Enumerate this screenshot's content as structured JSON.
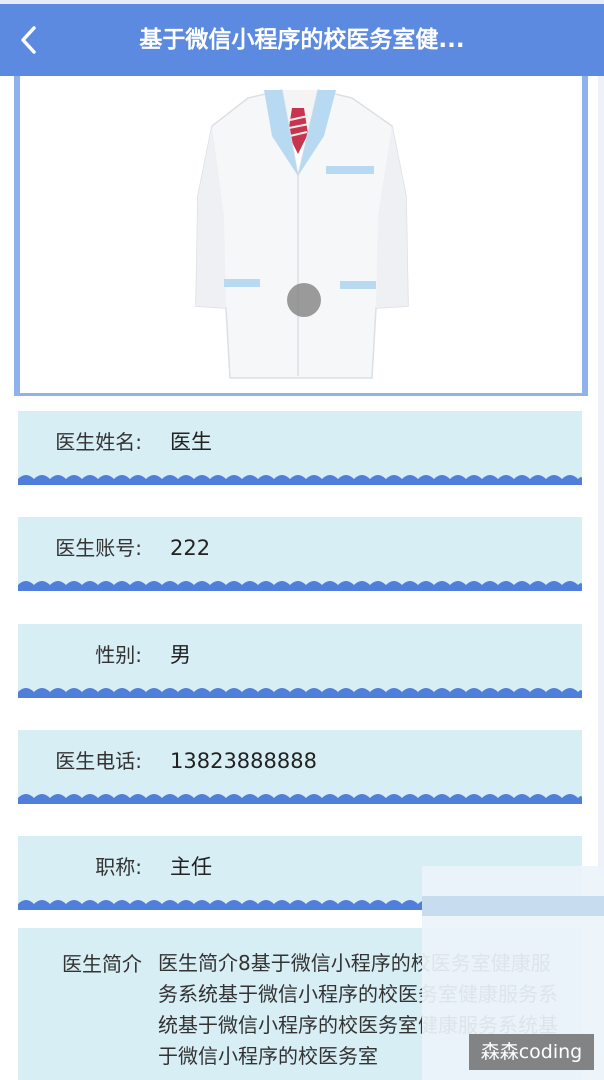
{
  "header": {
    "title": "基于微信小程序的校医务室健..."
  },
  "icons": {
    "back": "chevron-left-icon"
  },
  "colors": {
    "primary": "#5b8ae0",
    "row_bg": "#d7eef5",
    "wave": "#4f7fda"
  },
  "fields": [
    {
      "label": "医生姓名:",
      "value": "医生"
    },
    {
      "label": "医生账号:",
      "value": "222"
    },
    {
      "label": "性别:",
      "value": "男"
    },
    {
      "label": "医生电话:",
      "value": "13823888888"
    },
    {
      "label": "职称:",
      "value": "主任"
    }
  ],
  "intro": {
    "label": "医生简介",
    "text": "医生简介8基于微信小程序的校医务室健康服务系统基于微信小程序的校医务室健康服务系统基于微信小程序的校医务室健康服务系统基于微信小程序的校医务室"
  },
  "watermark": "森森coding"
}
